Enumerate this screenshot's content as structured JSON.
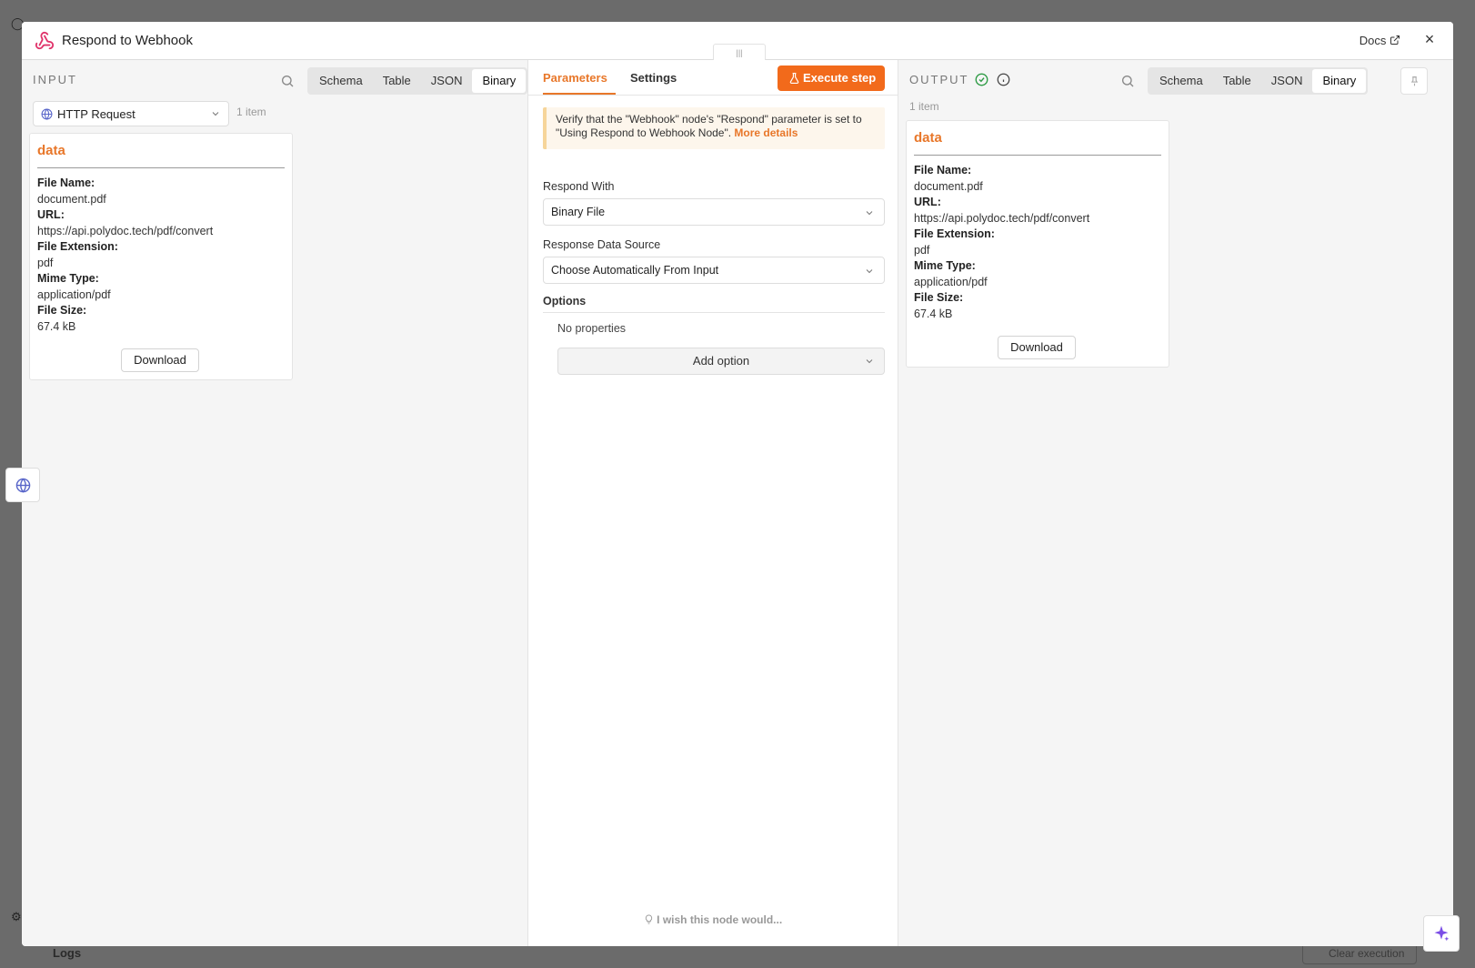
{
  "background": {
    "logs_label": "Logs",
    "clear_execution_label": "Clear execution"
  },
  "modal": {
    "title": "Respond to Webhook",
    "docs_label": "Docs",
    "close_label": "×"
  },
  "input": {
    "label": "INPUT",
    "view_tabs": [
      "Schema",
      "Table",
      "JSON",
      "Binary"
    ],
    "active_tab": "Binary",
    "node_select": "HTTP Request",
    "item_count": "1 item",
    "card": {
      "title": "data",
      "fields": [
        {
          "key": "File Name:",
          "value": "document.pdf"
        },
        {
          "key": "URL:",
          "value": "https://api.polydoc.tech/pdf/convert"
        },
        {
          "key": "File Extension:",
          "value": "pdf"
        },
        {
          "key": "Mime Type:",
          "value": "application/pdf"
        },
        {
          "key": "File Size:",
          "value": "67.4 kB"
        }
      ],
      "download_label": "Download"
    }
  },
  "center": {
    "tabs": {
      "parameters": "Parameters",
      "settings": "Settings"
    },
    "execute_label": "Execute step",
    "notice_text": "Verify that the \"Webhook\" node's \"Respond\" parameter is set to \"Using Respond to Webhook Node\".",
    "notice_link": "More details",
    "respond_with": {
      "label": "Respond With",
      "value": "Binary File"
    },
    "response_source": {
      "label": "Response Data Source",
      "value": "Choose Automatically From Input"
    },
    "options_label": "Options",
    "no_properties": "No properties",
    "add_option_label": "Add option",
    "wish_text": "I wish this node would..."
  },
  "output": {
    "label": "OUTPUT",
    "view_tabs": [
      "Schema",
      "Table",
      "JSON",
      "Binary"
    ],
    "active_tab": "Binary",
    "item_count": "1 item",
    "card": {
      "title": "data",
      "fields": [
        {
          "key": "File Name:",
          "value": "document.pdf"
        },
        {
          "key": "URL:",
          "value": "https://api.polydoc.tech/pdf/convert"
        },
        {
          "key": "File Extension:",
          "value": "pdf"
        },
        {
          "key": "Mime Type:",
          "value": "application/pdf"
        },
        {
          "key": "File Size:",
          "value": "67.4 kB"
        }
      ],
      "download_label": "Download"
    }
  },
  "colors": {
    "accent": "#e8772a",
    "execute_button": "#f26a1b",
    "success": "#2e9b45"
  }
}
